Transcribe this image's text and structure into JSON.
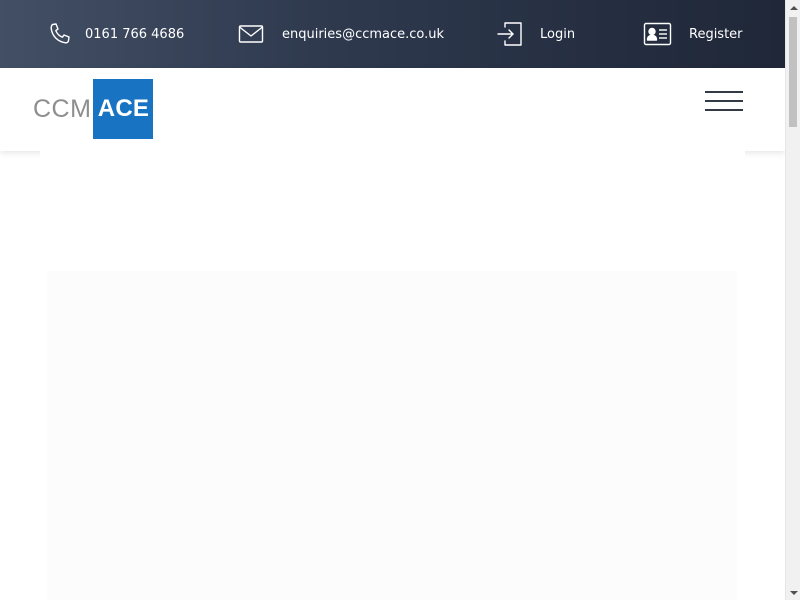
{
  "topbar": {
    "phone": {
      "icon": "phone-icon",
      "label": "0161 766 4686"
    },
    "email": {
      "icon": "envelope-icon",
      "label": "enquiries@ccmace.co.uk"
    },
    "login": {
      "icon": "login-icon",
      "label": "Login"
    },
    "register": {
      "icon": "id-card-icon",
      "label": "Register"
    },
    "colors": {
      "gradient_start": "#434f65",
      "gradient_end": "#1f2738",
      "text": "#ffffff"
    }
  },
  "header": {
    "logo": {
      "part1": "CCM",
      "part2": "ACE",
      "accent": "#1874c3",
      "grey": "#8e8e8e"
    },
    "menu_icon": "hamburger-menu-icon"
  }
}
